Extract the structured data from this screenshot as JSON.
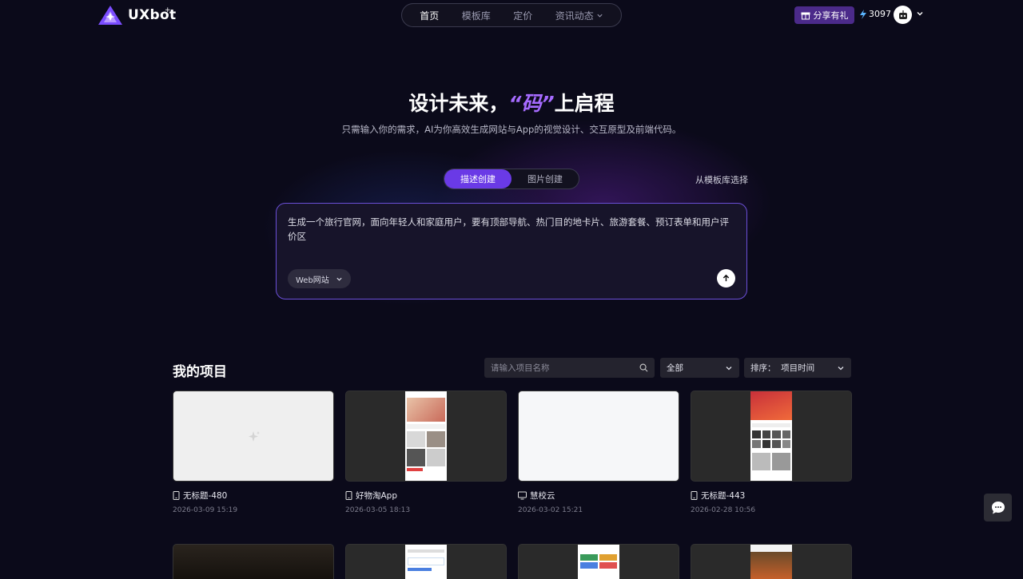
{
  "brand": {
    "name": "UXbot",
    "mark": "+"
  },
  "nav": [
    {
      "label": "首页",
      "active": true
    },
    {
      "label": "模板库",
      "active": false
    },
    {
      "label": "定价",
      "active": false
    },
    {
      "label": "资讯动态",
      "active": false
    }
  ],
  "header": {
    "gift_label": "分享有礼",
    "credits": "3097"
  },
  "hero": {
    "title_before": "设计未来，",
    "title_accent": "“码”",
    "title_after": "上启程",
    "subtitle": "只需输入你的需求，AI为你高效生成网站与App的视觉设计、交互原型及前端代码。"
  },
  "mode_tabs": [
    {
      "label": "描述创建",
      "active": true
    },
    {
      "label": "图片创建",
      "active": false
    }
  ],
  "template_link": "从模板库选择",
  "prompt": {
    "text": "生成一个旅行官网，面向年轻人和家庭用户，要有顶部导航、热门目的地卡片、旅游套餐、预订表单和用户评价区",
    "type_select": "Web网站"
  },
  "projects": {
    "title": "我的项目",
    "search_placeholder": "请输入项目名称",
    "filter": "全部",
    "sort": "排序：  项目时间",
    "items": [
      {
        "name": "无标题-480",
        "date": "2026-03-09 15:19",
        "device": "phone",
        "thumb": "blank"
      },
      {
        "name": "好物淘App",
        "date": "2026-03-05 18:13",
        "device": "phone",
        "thumb": "phone"
      },
      {
        "name": "慧校云",
        "date": "2026-03-02 15:21",
        "device": "desktop",
        "thumb": "white"
      },
      {
        "name": "无标题-443",
        "date": "2026-02-28 10:56",
        "device": "phone",
        "thumb": "phone"
      }
    ]
  },
  "colors": {
    "accent": "#6a3ae6",
    "accent_text": "#a66bff",
    "background": "#0b0a1a"
  }
}
